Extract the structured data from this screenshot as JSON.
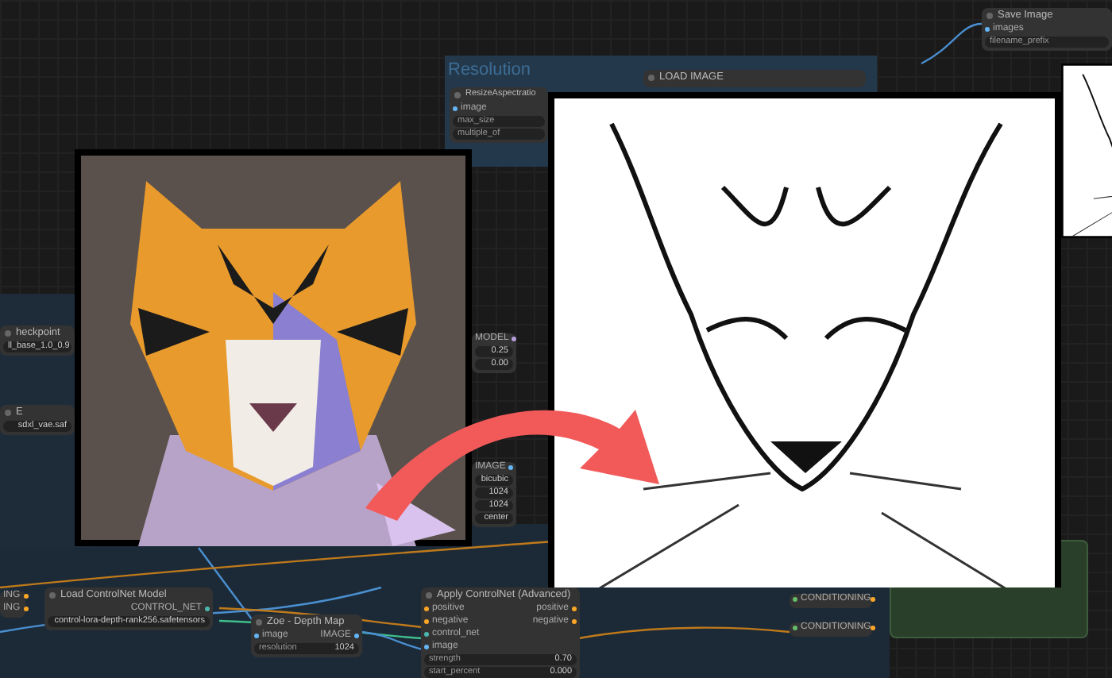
{
  "groups": [
    {
      "title": "Resolution"
    }
  ],
  "nodes": [
    {
      "title": "ResizeAspectratio",
      "inputs": [
        {
          "label": "image",
          "color": "#64b5f6"
        }
      ],
      "widgets": [
        {
          "label": "max_size"
        },
        {
          "label": "multiple_of"
        }
      ]
    },
    {
      "title": "LOAD IMAGE"
    },
    {
      "title": "Save Image",
      "inputs": [
        {
          "label": "images",
          "color": "#64b5f6"
        }
      ],
      "widgets": [
        {
          "label": "filename_prefix"
        }
      ]
    },
    {
      "title": "heckpoint",
      "widgets": [
        {
          "value": "ll_base_1.0_0.9"
        }
      ]
    },
    {
      "title": "E",
      "widgets": [
        {
          "value": "sdxl_vae.saf"
        }
      ]
    },
    {
      "outputs": [
        {
          "label": "MODEL",
          "color": "#b39ddb"
        }
      ],
      "widgets": [
        {
          "value": "0.25"
        },
        {
          "value": "0.00"
        }
      ]
    },
    {
      "outputs": [
        {
          "label": "IMAGE",
          "color": "#64b5f6"
        }
      ],
      "widgets": [
        {
          "value": "bicubic"
        },
        {
          "value": "1024"
        },
        {
          "value": "1024"
        },
        {
          "value": "center"
        }
      ]
    },
    {
      "outputs": [
        {
          "label": "ING",
          "color": "#ffa726"
        },
        {
          "label": "ING",
          "color": "#ffa726"
        }
      ]
    },
    {
      "title": "Load ControlNet Model",
      "outputs": [
        {
          "label": "CONTROL_NET",
          "color": "#4db6ac"
        }
      ],
      "widgets": [
        {
          "value": "control-lora-depth-rank256.safetensors"
        }
      ]
    },
    {
      "title": "Zoe - Depth Map",
      "inputs": [
        {
          "label": "image",
          "color": "#64b5f6"
        }
      ],
      "outputs": [
        {
          "label": "IMAGE",
          "color": "#64b5f6"
        }
      ],
      "widgets": [
        {
          "label": "resolution",
          "value": "1024"
        }
      ]
    },
    {
      "title": "Apply ControlNet (Advanced)",
      "inputs": [
        {
          "label": "positive",
          "color": "#ffa726"
        },
        {
          "label": "negative",
          "color": "#ffa726"
        },
        {
          "label": "control_net",
          "color": "#4db6ac"
        },
        {
          "label": "image",
          "color": "#64b5f6"
        }
      ],
      "outputs": [
        {
          "label": "positive",
          "color": "#ffa726"
        },
        {
          "label": "negative",
          "color": "#ffa726"
        }
      ],
      "widgets": [
        {
          "label": "strength",
          "value": "0.70"
        },
        {
          "label": "start_percent",
          "value": "0.000"
        }
      ]
    },
    {
      "inputs": [
        {
          "label": "CONDITIONING",
          "color": "#66bb6a"
        }
      ],
      "outputs": [
        {
          "color": "#ffa726"
        }
      ]
    },
    {
      "inputs": [
        {
          "label": "CONDITIONING",
          "color": "#66bb6a"
        }
      ],
      "outputs": [
        {
          "color": "#ffa726"
        }
      ]
    }
  ]
}
